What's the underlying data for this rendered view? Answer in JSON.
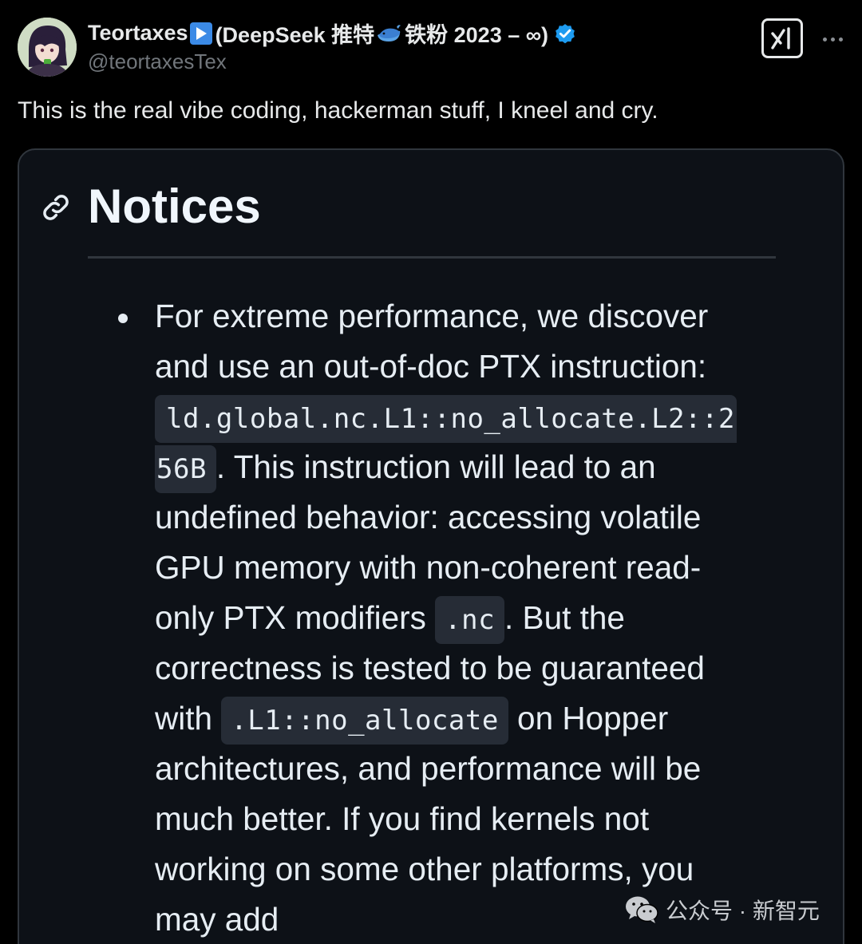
{
  "author": {
    "name": "Teortaxes",
    "name_cjk": "(DeepSeek 推特",
    "name_suffix": "铁粉 2023 – ∞)",
    "handle": "@teortaxesTex",
    "verified": true,
    "verified_color": "#1d9bf0"
  },
  "tweet": {
    "text": "This is the real vibe coding, hackerman stuff, I kneel and cry."
  },
  "card": {
    "heading": "Notices",
    "lines": {
      "l1": "For extreme performance, we discover",
      "l2": "and use an out-of-doc PTX instruction:",
      "code_ptx_a": "ld.global.nc.L1::no_allocate.L2::2",
      "code_ptx_b": "56B",
      "l4": ". This instruction will lead to an",
      "l5": "undefined behavior: accessing volatile",
      "l6": "GPU memory with non-coherent read-",
      "l7a": "only PTX modifiers ",
      "code_nc": ".nc",
      "l7b": ". But the",
      "l8": "correctness is tested to be guaranteed",
      "l9a": "with ",
      "code_l1": ".L1::no_allocate",
      "l9b": " on Hopper",
      "l10": "architectures, and performance will be",
      "l11": "much better. If you find kernels not",
      "l12": "working on some other platforms, you",
      "l13": "may add"
    }
  },
  "watermark": {
    "text": "公众号 · 新智元",
    "icon": "wechat-icon"
  },
  "icons": {
    "play": "play-button-icon",
    "whale": "whale-icon",
    "verified": "verified-badge-icon",
    "grok": "grok-icon",
    "more": "more-options-icon",
    "link": "link-icon"
  },
  "colors": {
    "background": "#000000",
    "card_background": "#0d1117",
    "code_background": "#262c36",
    "accent": "#1d9bf0"
  }
}
